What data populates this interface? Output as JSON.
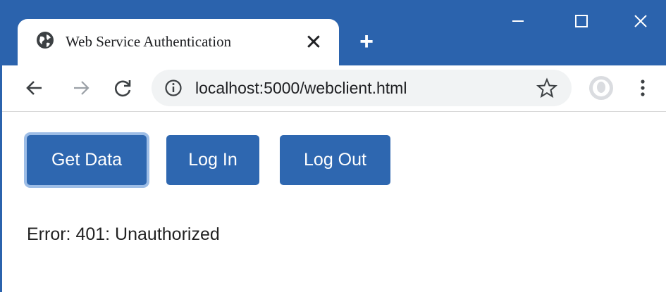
{
  "browser": {
    "tab": {
      "title": "Web Service Authentication",
      "icon": "globe-icon",
      "close_label": "✕"
    },
    "new_tab_label": "+",
    "window_controls": [
      "minimize-icon",
      "maximize-icon",
      "close-icon"
    ],
    "address": {
      "url": "localhost:5000/webclient.html",
      "icon": "info-icon"
    },
    "nav_icons": [
      "back-arrow-icon",
      "forward-arrow-icon",
      "reload-icon"
    ],
    "toolbar_icons": [
      "star-icon",
      "profile-avatar-icon",
      "more-vert-icon"
    ]
  },
  "page": {
    "buttons": {
      "get_data": "Get Data",
      "log_in": "Log In",
      "log_out": "Log Out"
    },
    "status_text": "Error: 401: Unauthorized"
  },
  "colors": {
    "titlebar": "#2b63ad",
    "button": "#2e67b0",
    "focus_ring": "#9dbde6"
  }
}
